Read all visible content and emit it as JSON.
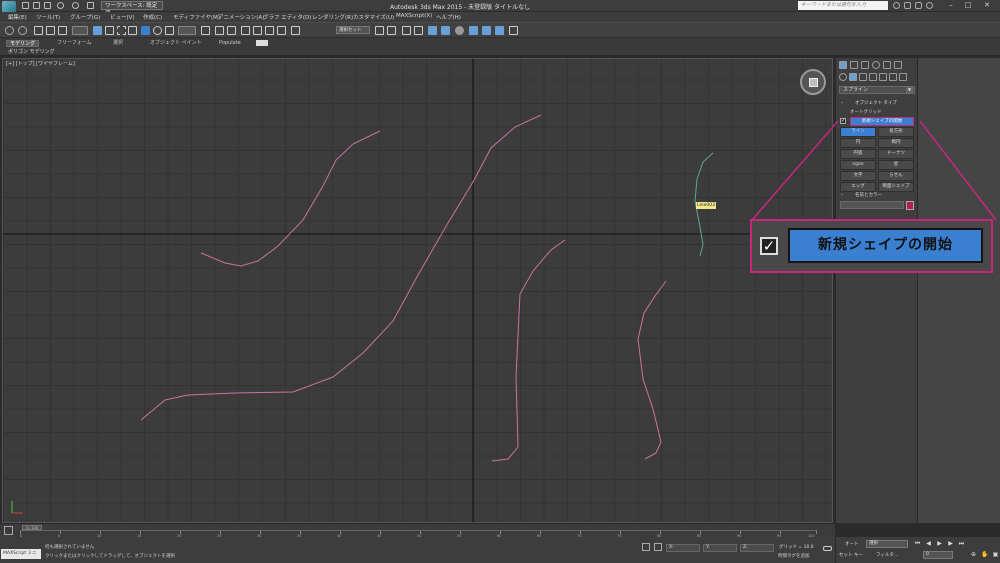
{
  "titlebar": {
    "workspace": "ワークスペース: 既定値",
    "app_title": "Autodesk 3ds Max  2015   - 未登録版    タイトルなし",
    "search_placeholder": "キーワードまたは語句を入力"
  },
  "menu": {
    "items": [
      "編集(E)",
      "ツール(T)",
      "グループ(G)",
      "ビュー(V)",
      "作成(C)",
      "モディファイヤ(M)",
      "アニメーション(A)",
      "グラフ エディタ(D)",
      "レンダリング(R)",
      "カスタマイズ(U)",
      "MAXScript(X)",
      "ヘルプ(H)"
    ]
  },
  "toolbar": {
    "selection_set": "選択セット"
  },
  "ribbon": {
    "tabs": [
      "モデリング",
      "フリーフォーム",
      "選択",
      "オブジェクト ペイント",
      "Populate"
    ],
    "subtab": "ポリゴン モデリング"
  },
  "viewport": {
    "label": "[+] [トップ] [ワイヤフレーム]",
    "object_label": "Line003"
  },
  "command_panel": {
    "category": "スプライン",
    "rollout_object_type": "オブジェクト タイプ",
    "autogrid": "オートグリッド",
    "start_new_shape_checked": true,
    "start_new_shape": "新規シェイプの開始",
    "shape_buttons": [
      "ライン",
      "長方形",
      "円",
      "楕円",
      "円弧",
      "ドーナツ",
      "ngon",
      "星",
      "文字",
      "らせん",
      "エッグ",
      "断面シェイプ"
    ],
    "rollout_name_color": "名前とカラー",
    "object_color": "#b01e55"
  },
  "timeline": {
    "frame": "0 / 100",
    "ticks": [
      "0",
      "5",
      "10",
      "15",
      "20",
      "25",
      "30",
      "35",
      "40",
      "45",
      "50",
      "55",
      "60",
      "65",
      "70",
      "75",
      "80",
      "85",
      "90",
      "95",
      "100"
    ]
  },
  "status": {
    "maxscript": "MAXScript ミニ",
    "line1": "何も選択されていません",
    "line2": "クリックまたはクリックしてドラッグして、オブジェクトを選択",
    "x": "X:",
    "y": "Y:",
    "z": "Z:",
    "grid": "グリッド = 10.0",
    "add_time_tag": "時間タグを追加"
  },
  "keys": {
    "auto": "オート",
    "selected": "選択",
    "set_key": "セット キー",
    "filter": "フィルタ...",
    "frame_value": "0"
  },
  "callout": {
    "checked": true,
    "label": "新規シェイプの開始"
  },
  "colors": {
    "accent": "#c8267a",
    "button_blue": "#3a7fd0",
    "spline_pink": "#c8759e",
    "spline_green": "#5fa39a"
  }
}
